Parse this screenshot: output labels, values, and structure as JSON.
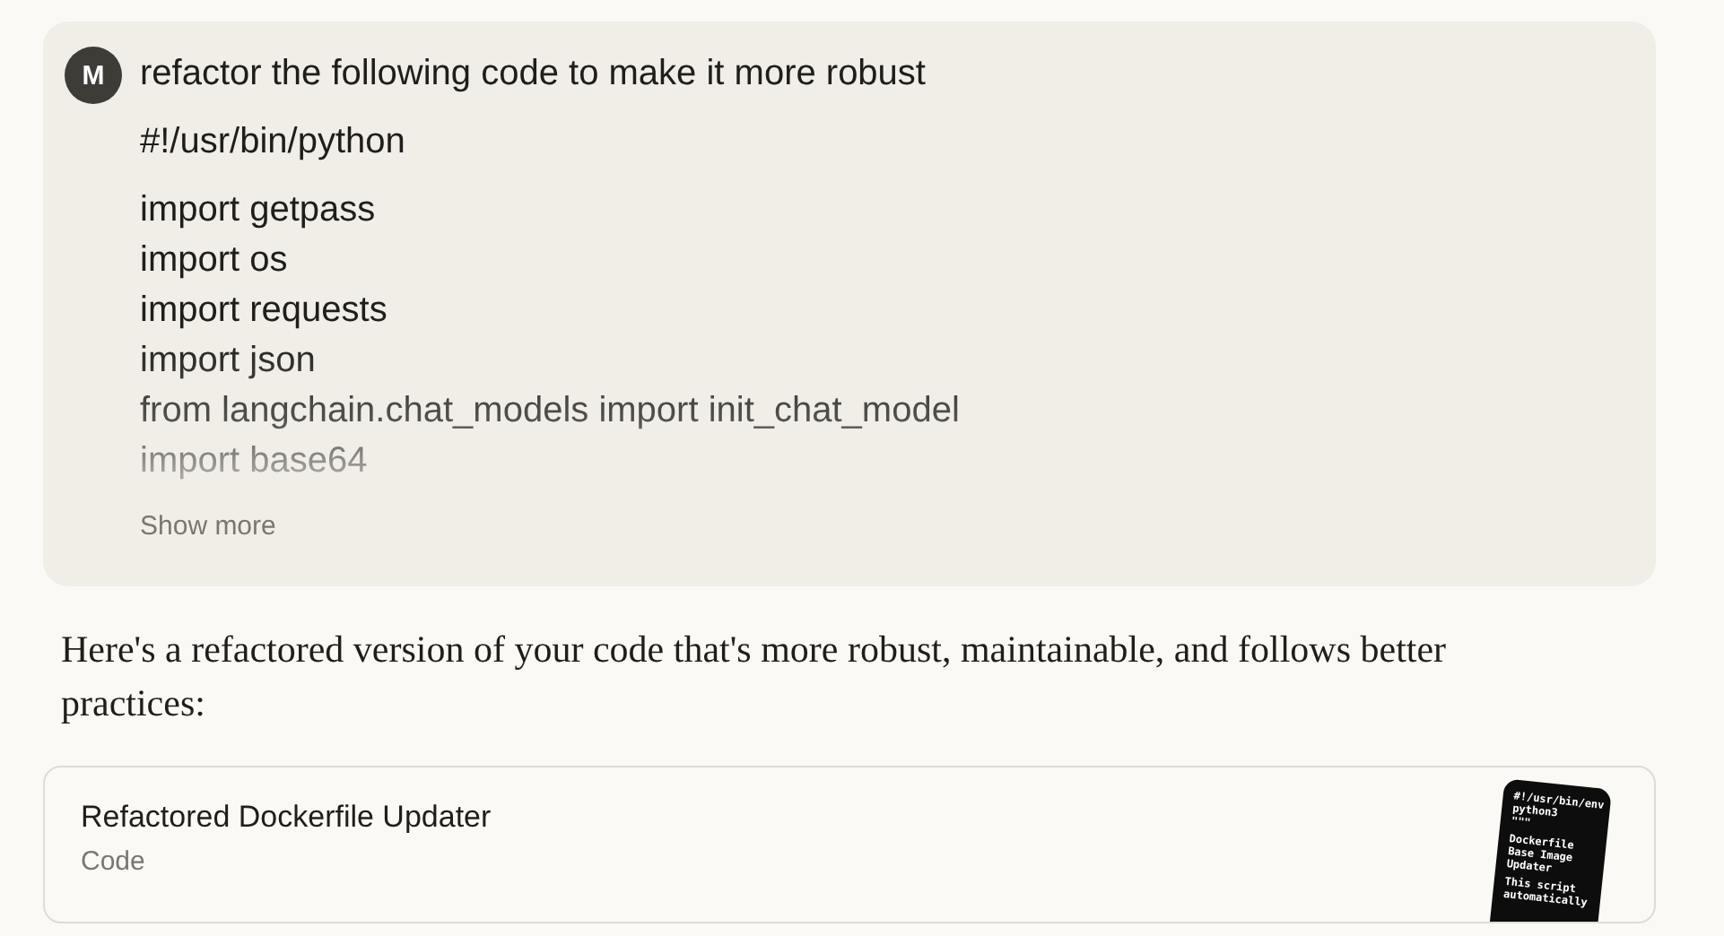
{
  "user_message": {
    "avatar": "M",
    "text": "refactor the following code to make it more robust",
    "code_lines": [
      "#!/usr/bin/python",
      "import getpass",
      "import os",
      "import requests",
      "import json",
      "from langchain.chat_models import init_chat_model",
      "import base64"
    ],
    "show_more": "Show more"
  },
  "response": {
    "text": "Here's a refactored version of your code that's more robust, maintainable, and follows better practices:"
  },
  "artifact": {
    "title": "Refactored Dockerfile Updater",
    "type": "Code",
    "preview_blocks": [
      [
        "#!/usr/bin/env",
        "python3",
        "\"\"\""
      ],
      [
        "Dockerfile",
        "Base Image",
        "Updater"
      ],
      [
        "This script",
        "automatically"
      ]
    ]
  }
}
